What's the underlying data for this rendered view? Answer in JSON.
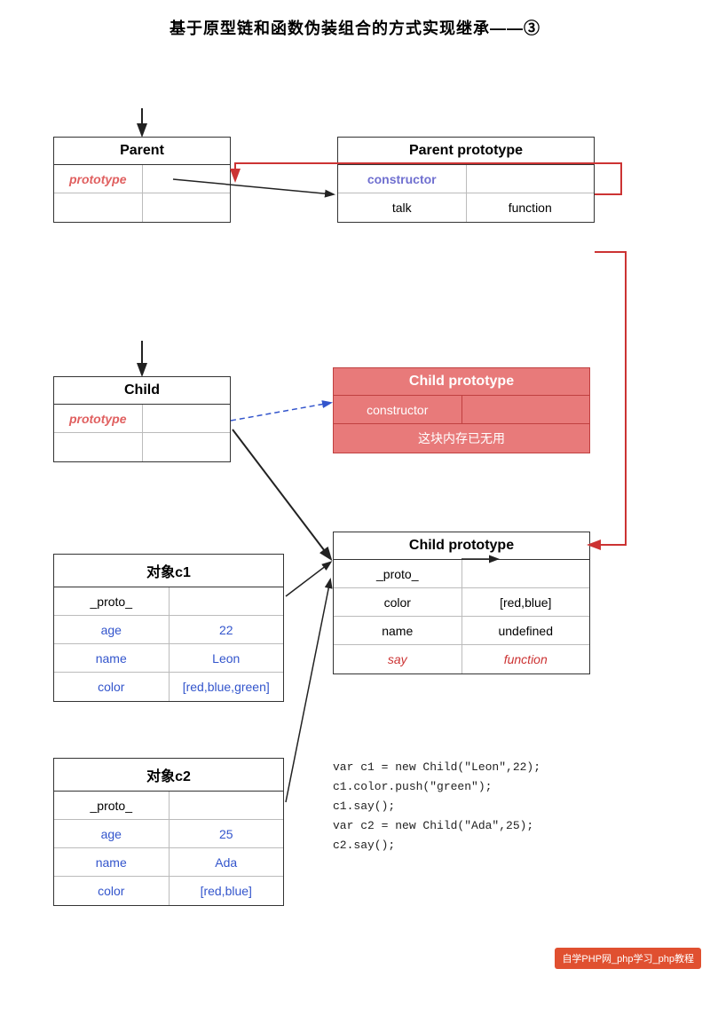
{
  "title": "基于原型链和函数伪装组合的方式实现继承——③",
  "parent_box": {
    "header": "Parent",
    "rows": [
      [
        "prototype",
        ""
      ],
      [
        "",
        ""
      ]
    ]
  },
  "parent_proto_box": {
    "header": "Parent prototype",
    "rows": [
      [
        "constructor",
        ""
      ],
      [
        "talk",
        "function"
      ]
    ]
  },
  "child_box": {
    "header": "Child",
    "rows": [
      [
        "prototype",
        ""
      ],
      [
        "",
        ""
      ]
    ]
  },
  "child_proto_old_box": {
    "header": "Child prototype",
    "rows": [
      [
        "constructor",
        ""
      ],
      [
        "这块内存已无用",
        ""
      ]
    ]
  },
  "obj_c1_box": {
    "header": "对象c1",
    "rows": [
      [
        "_proto_",
        ""
      ],
      [
        "age",
        "22"
      ],
      [
        "name",
        "Leon"
      ],
      [
        "color",
        "[red,blue,green]"
      ]
    ]
  },
  "child_proto_new_box": {
    "header": "Child prototype",
    "rows": [
      [
        "_proto_",
        ""
      ],
      [
        "color",
        "[red,blue]"
      ],
      [
        "name",
        "undefined"
      ],
      [
        "say",
        "function"
      ]
    ]
  },
  "obj_c2_box": {
    "header": "对象c2",
    "rows": [
      [
        "_proto_",
        ""
      ],
      [
        "age",
        "25"
      ],
      [
        "name",
        "Ada"
      ],
      [
        "color",
        "[red,blue]"
      ]
    ]
  },
  "code": [
    "var c1 = new Child(\"Leon\",22);",
    "c1.color.push(\"green\");",
    "c1.say();",
    "var c2 = new Child(\"Ada\",25);",
    "c2.say();"
  ],
  "footer": "自学PHP网_php学习_php教程"
}
